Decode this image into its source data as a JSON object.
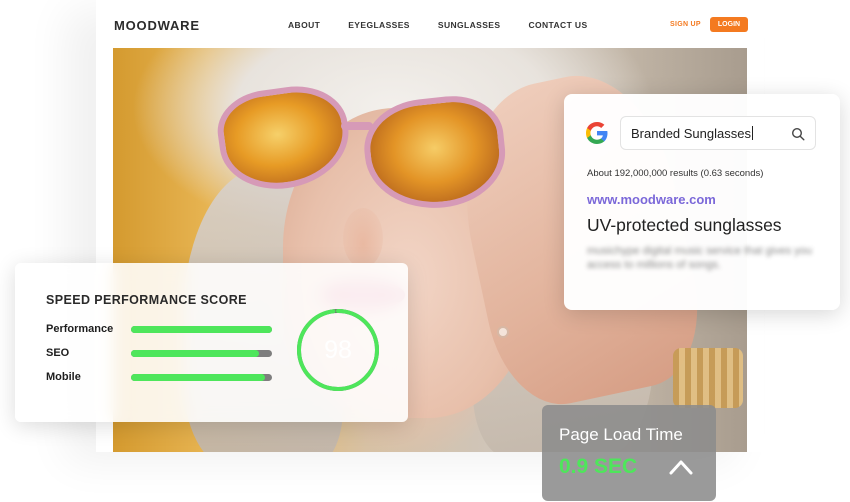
{
  "site": {
    "logo": "MOODWARE",
    "nav": [
      "ABOUT",
      "EYEGLASSES",
      "SUNGLASSES",
      "CONTACT US"
    ],
    "signup": "SIGN UP",
    "login": "LOGIN",
    "accent_color": "#f47a20"
  },
  "search": {
    "query": "Branded Sunglasses",
    "results_count": "About 192,000,000 results (0.63 seconds)",
    "url": "www.moodware.com",
    "title": "UV-protected sunglasses",
    "snippet": "musichype digital music service that gives you access to millions of songs.",
    "link_color": "#7b68d9",
    "icons": [
      "google-logo-icon",
      "search-icon"
    ]
  },
  "speed": {
    "title": "SPEED PERFORMANCE SCORE",
    "metrics": [
      {
        "label": "Performance",
        "fill": 1.0
      },
      {
        "label": "SEO",
        "fill": 0.91
      },
      {
        "label": "Mobile",
        "fill": 0.95
      }
    ],
    "score": "98",
    "score_fraction": 0.98,
    "good_color": "#4ee65b"
  },
  "load": {
    "title": "Page Load Time",
    "value": "0.9 SEC",
    "icon": "chevron-up-icon"
  }
}
